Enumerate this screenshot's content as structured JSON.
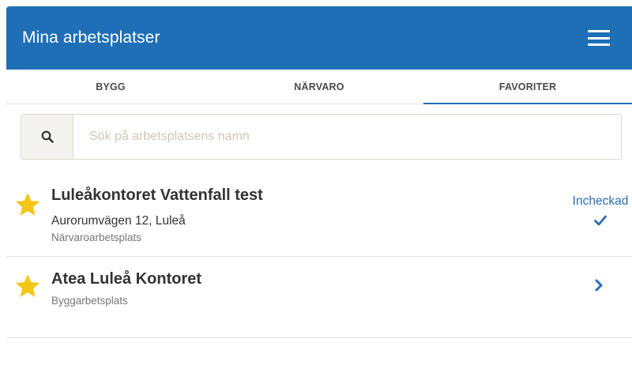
{
  "header": {
    "title": "Mina arbetsplatser",
    "menu_icon": "hamburger-menu-icon"
  },
  "tabs": [
    {
      "label": "BYGG",
      "active": false
    },
    {
      "label": "NÄRVARO",
      "active": false
    },
    {
      "label": "FAVORITER",
      "active": true
    }
  ],
  "search": {
    "placeholder": "Sök på arbetsplatsens namn",
    "value": "",
    "icon": "search-icon"
  },
  "workplaces": [
    {
      "name": "Luleåkontoret Vattenfall test",
      "address": "Aurorumvägen 12, Luleå",
      "type": "Närvaroarbetsplats",
      "favorite": true,
      "status": "Incheckad",
      "status_icon": "checkmark-icon"
    },
    {
      "name": "Atea Luleå Kontoret",
      "type": "Byggarbetsplats",
      "favorite": true,
      "action_icon": "chevron-right-icon"
    }
  ],
  "colors": {
    "primary": "#1f6fb6",
    "star": "#f5c518",
    "status": "#2a6fb0"
  }
}
